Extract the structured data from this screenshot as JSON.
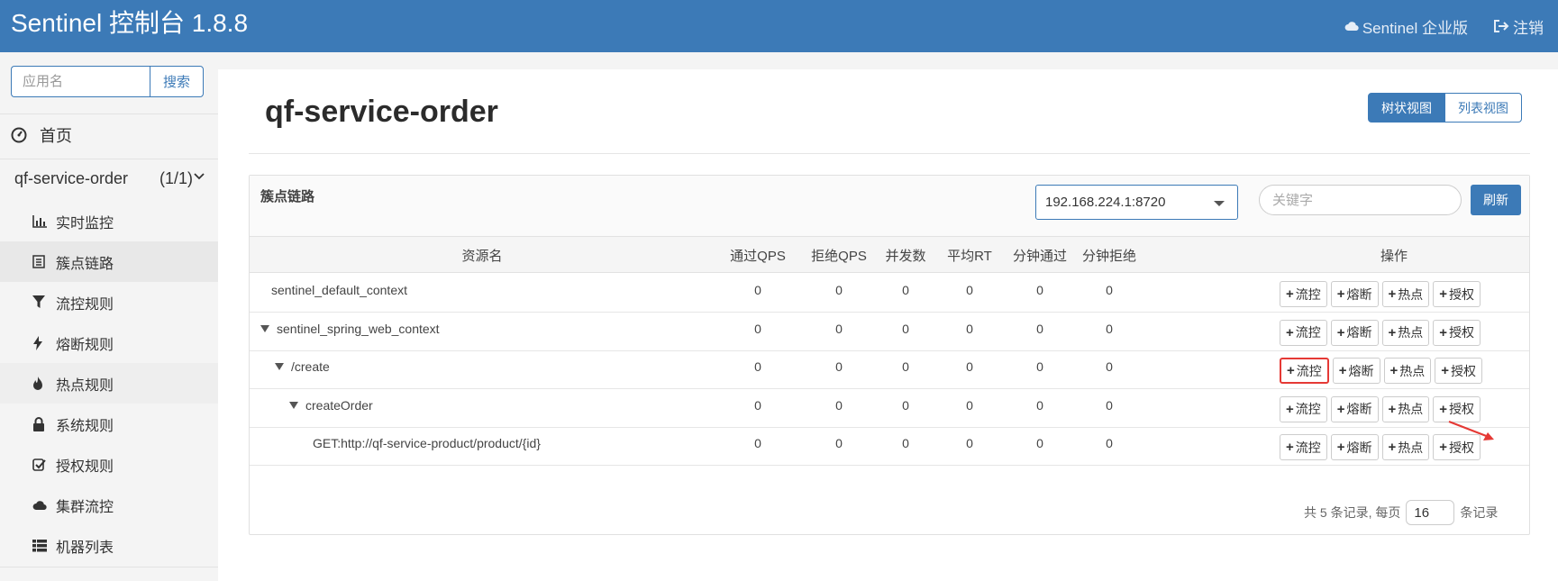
{
  "header": {
    "title": "Sentinel 控制台 1.8.8",
    "enterprise_label": "Sentinel 企业版",
    "logout_label": "注销"
  },
  "sidebar": {
    "search_placeholder": "应用名",
    "search_button": "搜索",
    "home_label": "首页",
    "app_name": "qf-service-order",
    "app_count": "(1/1)",
    "menu": [
      {
        "label": "实时监控",
        "icon": "bar-chart-icon"
      },
      {
        "label": "簇点链路",
        "icon": "list-alt-icon"
      },
      {
        "label": "流控规则",
        "icon": "filter-icon"
      },
      {
        "label": "熔断规则",
        "icon": "flash-icon"
      },
      {
        "label": "热点规则",
        "icon": "fire-icon"
      },
      {
        "label": "系统规则",
        "icon": "lock-icon"
      },
      {
        "label": "授权规则",
        "icon": "check-icon"
      },
      {
        "label": "集群流控",
        "icon": "cloud-icon"
      },
      {
        "label": "机器列表",
        "icon": "th-list-icon"
      }
    ],
    "active_menu": "簇点链路"
  },
  "main": {
    "page_title": "qf-service-order",
    "view_tree": "树状视图",
    "view_list": "列表视图",
    "card_title": "簇点链路",
    "machine_select": "192.168.224.1:8720",
    "keyword_placeholder": "关键字",
    "refresh_button": "刷新",
    "columns": {
      "resource": "资源名",
      "pass_qps": "通过QPS",
      "block_qps": "拒绝QPS",
      "concurrency": "并发数",
      "avg_rt": "平均RT",
      "minute_pass": "分钟通过",
      "minute_block": "分钟拒绝",
      "ops": "操作"
    },
    "rows": [
      {
        "name": "sentinel_default_context",
        "level": 0,
        "expandable": false,
        "pass": "0",
        "block": "0",
        "conc": "0",
        "rt": "0",
        "mpass": "0",
        "mblock": "0"
      },
      {
        "name": "sentinel_spring_web_context",
        "level": 0,
        "expandable": true,
        "pass": "0",
        "block": "0",
        "conc": "0",
        "rt": "0",
        "mpass": "0",
        "mblock": "0"
      },
      {
        "name": "/create",
        "level": 1,
        "expandable": true,
        "pass": "0",
        "block": "0",
        "conc": "0",
        "rt": "0",
        "mpass": "0",
        "mblock": "0"
      },
      {
        "name": "createOrder",
        "level": 2,
        "expandable": true,
        "pass": "0",
        "block": "0",
        "conc": "0",
        "rt": "0",
        "mpass": "0",
        "mblock": "0"
      },
      {
        "name": "GET:http://qf-service-product/product/{id}",
        "level": 3,
        "expandable": false,
        "pass": "0",
        "block": "0",
        "conc": "0",
        "rt": "0",
        "mpass": "0",
        "mblock": "0"
      }
    ],
    "op_labels": {
      "flow": "流控",
      "degrade": "熔断",
      "hotspot": "热点",
      "authority": "授权"
    },
    "highlighted_op": {
      "row": 2,
      "op": "flow",
      "color": "#e53935"
    },
    "pagination": {
      "prefix": "共 5 条记录, 每页",
      "page_size": "16",
      "suffix": "条记录"
    }
  },
  "colors": {
    "primary": "#3c7ab7",
    "highlight": "#e53935"
  }
}
